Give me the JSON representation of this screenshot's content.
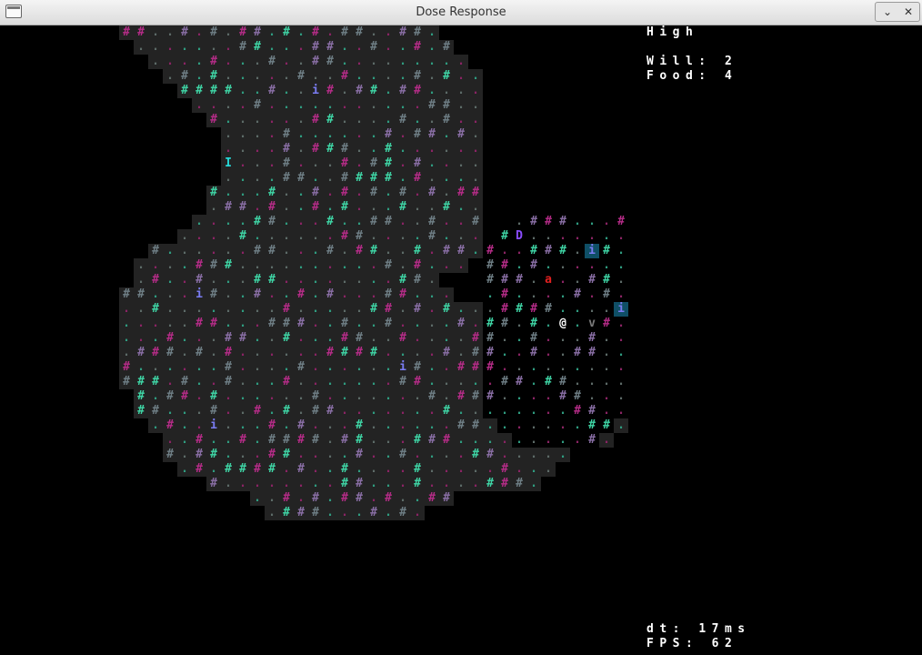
{
  "window": {
    "title": "Dose Response",
    "minimize_label": "⌄",
    "close_label": "✕"
  },
  "hud": {
    "state": "High",
    "will_label": "Will:",
    "will_value": "2",
    "food_label": "Food:",
    "food_value": "4",
    "dt_label": "dt:",
    "dt_value": "17ms",
    "fps_label": "FPS:",
    "fps_value": "62"
  },
  "colors": {
    "floor_bg": "#232323",
    "wall_teal": "#3fd6a6",
    "wall_magenta": "#b62c88",
    "wall_purple": "#8a6fa6",
    "wall_gray": "#6f7f86",
    "dot_teal": "#2f9c80",
    "dot_magenta": "#8a2464",
    "dot_gray": "#5d6b68",
    "player": "#ffffff",
    "item_i": "#7a7cf2",
    "item_I": "#26d6d6",
    "monster_D": "#8a4cff",
    "monster_a": "#e02020",
    "monster_v": "#7a7a7a",
    "highlight_bg": "#0f4f66"
  },
  "entities": [
    {
      "name": "player",
      "glyph": "@",
      "color": "player"
    },
    {
      "name": "item-i",
      "glyph": "i",
      "color": "item_i"
    },
    {
      "name": "item-I",
      "glyph": "I",
      "color": "item_I"
    },
    {
      "name": "monster-D",
      "glyph": "D",
      "color": "monster_D"
    },
    {
      "name": "monster-a",
      "glyph": "a",
      "color": "monster_a"
    },
    {
      "name": "monster-v",
      "glyph": "v",
      "color": "monster_v"
    }
  ]
}
